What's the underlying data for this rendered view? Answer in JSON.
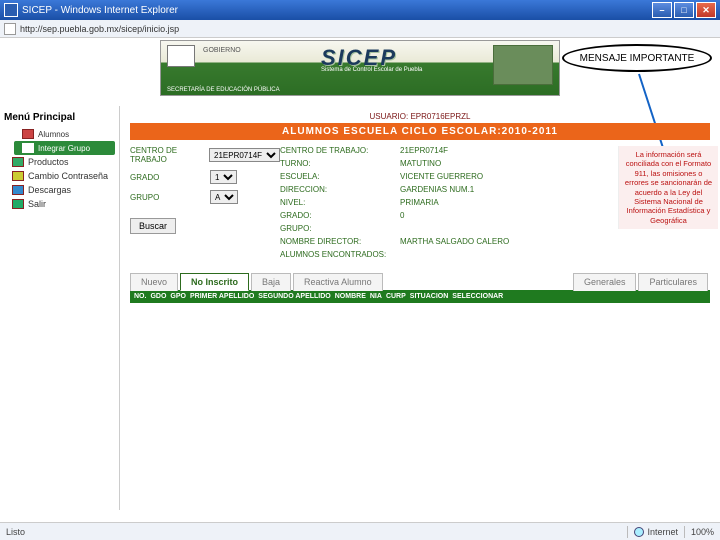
{
  "window": {
    "title": "SICEP - Windows Internet Explorer",
    "url": "http://sep.puebla.gob.mx/sicep/inicio.jsp"
  },
  "banner": {
    "gobierno": "GOBIERNO",
    "sicep": "SICEP",
    "sicep_sub": "Sistema de Control Escolar de Puebla",
    "sep": "SECRETARÍA DE EDUCACIÓN PÚBLICA"
  },
  "callout": {
    "label": "MENSAJE IMPORTANTE"
  },
  "sidebar": {
    "title": "Menú Principal",
    "items": [
      {
        "label": "Alumnos"
      },
      {
        "label": "Integrar Grupo"
      },
      {
        "label": "Productos"
      },
      {
        "label": "Cambio Contraseña"
      },
      {
        "label": "Descargas"
      },
      {
        "label": "Salir"
      }
    ]
  },
  "content": {
    "usuario_label": "USUARIO:",
    "usuario_value": "EPR0716EPRZL",
    "section_title": "ALUMNOS ESCUELA CICLO ESCOLAR:2010-2011",
    "filters": {
      "centro_label": "CENTRO DE TRABAJO",
      "centro_value": "21EPR0714F",
      "grado_label": "GRADO",
      "grado_value": "1",
      "grupo_label": "GRUPO",
      "grupo_value": "A",
      "buscar": "Buscar"
    },
    "info": [
      {
        "lbl": "CENTRO DE TRABAJO:",
        "val": "21EPR0714F"
      },
      {
        "lbl": "TURNO:",
        "val": "MATUTINO"
      },
      {
        "lbl": "ESCUELA:",
        "val": "VICENTE GUERRERO"
      },
      {
        "lbl": "DIRECCION:",
        "val": "GARDENIAS NUM.1"
      },
      {
        "lbl": "NIVEL:",
        "val": "PRIMARIA"
      },
      {
        "lbl": "GRADO:",
        "val": "0"
      },
      {
        "lbl": "GRUPO:",
        "val": ""
      },
      {
        "lbl": "NOMBRE DIRECTOR:",
        "val": "MARTHA SALGADO CALERO"
      },
      {
        "lbl": "ALUMNOS ENCONTRADOS:",
        "val": ""
      }
    ],
    "warning": "La información será conciliada con el Formato 911, las omisiones o errores se sancionarán de acuerdo a la Ley del Sistema Nacional de Información Estadística y Geográfica",
    "tabs": [
      {
        "label": "Nuevo"
      },
      {
        "label": "No Inscrito"
      },
      {
        "label": "Baja"
      },
      {
        "label": "Reactiva Alumno"
      },
      {
        "label": "Generales"
      },
      {
        "label": "Particulares"
      }
    ],
    "grid_columns": [
      "NO.",
      "GDO",
      "GPO",
      "PRIMER APELLIDO",
      "SEGUNDO APELLIDO",
      "NOMBRE",
      "NIA",
      "CURP",
      "SITUACION",
      "SELECCIONAR"
    ]
  },
  "statusbar": {
    "left": "Listo",
    "zone": "Internet",
    "zoom": "100%"
  }
}
